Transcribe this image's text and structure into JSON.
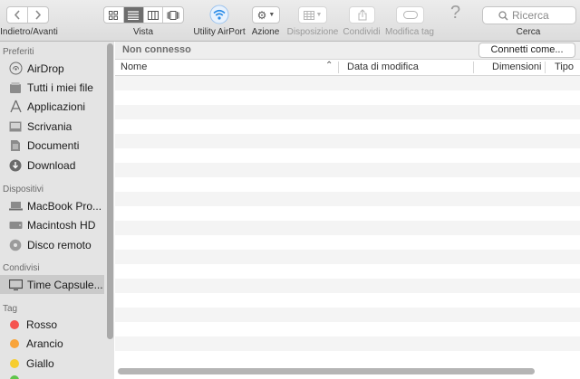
{
  "toolbar": {
    "nav_label": "Indietro/Avanti",
    "view_label": "Vista",
    "airport_label": "Utility AirPort",
    "action_label": "Azione",
    "arrange_label": "Disposizione",
    "share_label": "Condividi",
    "tags_label": "Modifica tag",
    "search_label": "Cerca",
    "search_placeholder": "Ricerca",
    "help_icon": "?"
  },
  "sidebar": {
    "favorites_header": "Preferiti",
    "favorites": [
      {
        "label": "AirDrop",
        "icon": "airdrop-icon"
      },
      {
        "label": "Tutti i miei file",
        "icon": "all-files-icon"
      },
      {
        "label": "Applicazioni",
        "icon": "applications-icon"
      },
      {
        "label": "Scrivania",
        "icon": "desktop-icon"
      },
      {
        "label": "Documenti",
        "icon": "documents-icon"
      },
      {
        "label": "Download",
        "icon": "download-icon"
      }
    ],
    "devices_header": "Dispositivi",
    "devices": [
      {
        "label": "MacBook Pro...",
        "icon": "laptop-icon"
      },
      {
        "label": "Macintosh HD",
        "icon": "hard-drive-icon"
      },
      {
        "label": "Disco remoto",
        "icon": "remote-disc-icon"
      }
    ],
    "shared_header": "Condivisi",
    "shared": [
      {
        "label": "Time Capsule...",
        "icon": "display-icon",
        "selected": true
      }
    ],
    "tags_header": "Tag",
    "tags": [
      {
        "label": "Rosso",
        "color": "#f5534f"
      },
      {
        "label": "Arancio",
        "color": "#f8a43a"
      },
      {
        "label": "Giallo",
        "color": "#f6cd2f"
      }
    ]
  },
  "main": {
    "status": "Non connesso",
    "connect_button": "Connetti come...",
    "columns": {
      "name": "Nome",
      "modified": "Data di modifica",
      "size": "Dimensioni",
      "kind": "Tipo"
    }
  },
  "colors": {
    "selected_view": "#6e6e6e",
    "airport_blue": "#2d8de8"
  }
}
